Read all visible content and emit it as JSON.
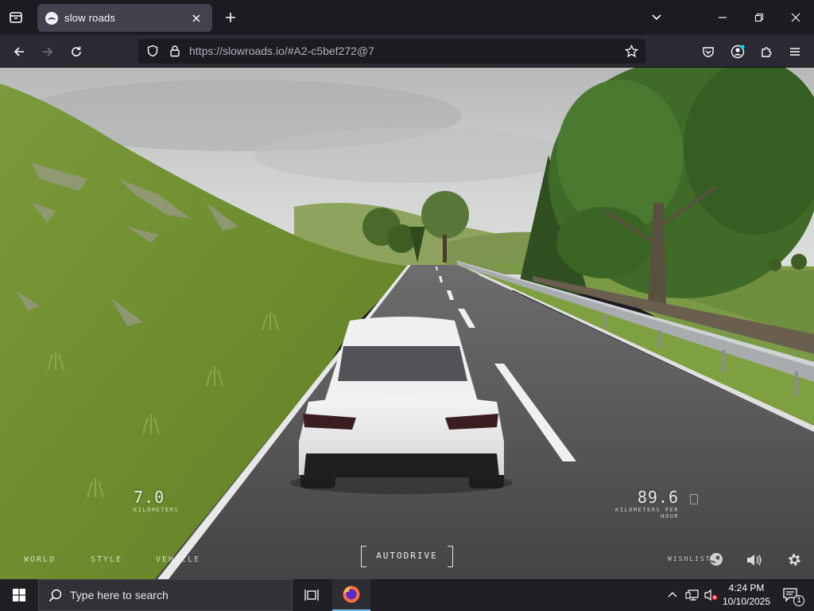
{
  "browser": {
    "tab_title": "slow roads",
    "url_host": "https://slowroads.io",
    "url_rest": "/#A2-c5bef272@7"
  },
  "hud": {
    "distance_value": "7.0",
    "distance_unit": "KILOMETERS",
    "speed_value": "89.6",
    "speed_unit": "KILOMETERS PER HOUR",
    "menu_world": "WORLD",
    "menu_style": "STYLE",
    "menu_vehicle": "VEHICLE",
    "autodrive_label": "AUTODRIVE",
    "wishlist_label": "WISHLIST"
  },
  "taskbar": {
    "search_placeholder": "Type here to search",
    "time": "4:24 PM",
    "date": "10/10/2025",
    "notification_count": "1"
  },
  "colors": {
    "chrome_dark": "#1c1b22",
    "toolbar": "#2b2a33",
    "taskbar": "#1f1f24",
    "sky": "#c9cccd",
    "grass": "#7f9a3e",
    "road": "#4a4a4c",
    "car": "#ececec"
  }
}
